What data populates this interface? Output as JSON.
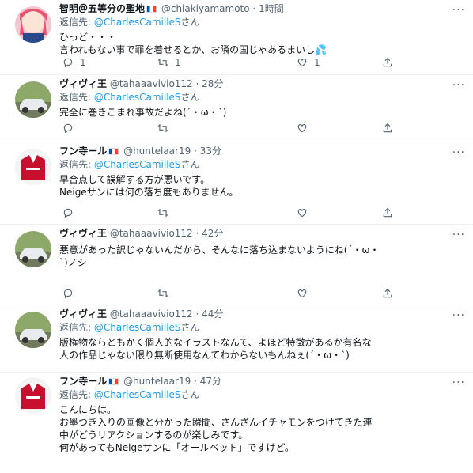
{
  "tweets": [
    {
      "name": "智明＠五等分の聖地",
      "handle": "@chiakiyamamoto",
      "time": "1時間",
      "reply_prefix": "返信先: ",
      "reply_to": "@CharlesCamilleS",
      "reply_suffix": "さん",
      "lines": [
        "ひっど・・・",
        "言われもない事で罪を着せるとか、お隣の国じゃあるまいし💦"
      ],
      "reply_count": "1",
      "retweet_count": "1",
      "like_count": "1"
    },
    {
      "name": "ヴィヴィ王",
      "handle": "@tahaaavivio112",
      "time": "28分",
      "reply_prefix": "返信先: ",
      "reply_to": "@CharlesCamilleS",
      "reply_suffix": "さん",
      "lines": [
        "完全に巻きこまれ事故だよね(´・ω・`)"
      ],
      "reply_count": "",
      "retweet_count": "",
      "like_count": ""
    },
    {
      "name": "フン寺ール",
      "handle": "@huntelaar19",
      "time": "33分",
      "reply_prefix": "返信先: ",
      "reply_to": "@CharlesCamilleS",
      "reply_suffix": "さん",
      "lines": [
        "早合点して誤解する方が悪いです。",
        "Neigeサンには何の落ち度もありません。"
      ],
      "reply_count": "",
      "retweet_count": "",
      "like_count": ""
    },
    {
      "name": "ヴィヴィ王",
      "handle": "@tahaaavivio112",
      "time": "42分",
      "reply_prefix": "",
      "reply_to": "",
      "reply_suffix": "",
      "lines": [
        "悪意があった訳じゃないんだから、そんなに落ち込まないようにね(´・ω・",
        "`)ノシ"
      ],
      "reply_count": "",
      "retweet_count": "",
      "like_count": ""
    },
    {
      "name": "ヴィヴィ王",
      "handle": "@tahaaavivio112",
      "time": "44分",
      "reply_prefix": "返信先: ",
      "reply_to": "@CharlesCamilleS",
      "reply_suffix": "さん",
      "lines": [
        "版権物ならともかく個人的なイラストなんて、よほど特徴があるか有名な",
        "人の作品じゃない限り無断使用なんてわからないもんねぇ(´・ω・`)"
      ],
      "reply_count": "",
      "retweet_count": "",
      "like_count": ""
    },
    {
      "name": "フン寺ール",
      "handle": "@huntelaar19",
      "time": "47分",
      "reply_prefix": "返信先: ",
      "reply_to": "@CharlesCamilleS",
      "reply_suffix": "さん",
      "lines": [
        "こんにちは。",
        "お墨つき入りの画像と分かった瞬間、さんざんイチャモンをつけてきた連",
        "中がどうリアクションするのが楽しみです。",
        "何があってもNeigeサンに「オールベット」ですけど。"
      ],
      "reply_count": "",
      "retweet_count": "",
      "like_count": ""
    }
  ],
  "separator": "·",
  "icons": {
    "reply": "reply-icon",
    "retweet": "retweet-icon",
    "like": "like-icon",
    "share": "share-icon",
    "more": "more-icon"
  },
  "colors": {
    "mention": "#1d9bf0",
    "secondary": "#536471"
  }
}
